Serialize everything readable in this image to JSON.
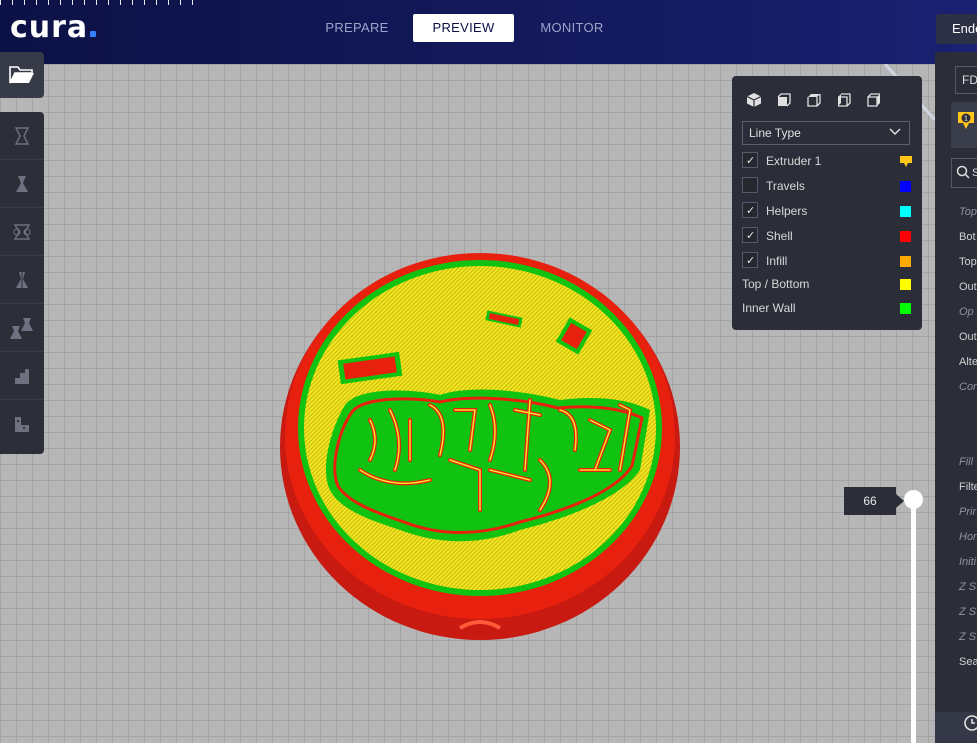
{
  "app": {
    "logo": "cura",
    "accent": "#3282ff"
  },
  "stages": [
    {
      "label": "PREPARE",
      "active": false
    },
    {
      "label": "PREVIEW",
      "active": true
    },
    {
      "label": "MONITOR",
      "active": false
    }
  ],
  "printer": {
    "name": "Ende"
  },
  "toolbar": {
    "open_icon": "folder-open-icon",
    "tools": [
      "move-icon",
      "scale-icon",
      "rotate-icon",
      "mirror-icon",
      "per-model-settings-icon",
      "support-blocker-icon",
      "layer-icon"
    ]
  },
  "legend": {
    "view_icons": [
      "3d-view-icon",
      "front-view-icon",
      "top-view-icon",
      "left-view-icon",
      "right-view-icon"
    ],
    "view_type": "Line Type",
    "checkbox_items": [
      {
        "label": "Extruder 1",
        "checked": true,
        "color": "#ffc619",
        "icon": "extruder-icon"
      },
      {
        "label": "Travels",
        "checked": false,
        "color": "#0000ff"
      },
      {
        "label": "Helpers",
        "checked": true,
        "color": "#00ffff"
      },
      {
        "label": "Shell",
        "checked": true,
        "color": "#ff0000"
      },
      {
        "label": "Infill",
        "checked": true,
        "color": "#ffaa00"
      }
    ],
    "plain_items": [
      {
        "label": "Top / Bottom",
        "color": "#ffff00"
      },
      {
        "label": "Inner Wall",
        "color": "#00ff00"
      }
    ]
  },
  "layer_slider": {
    "current": "66"
  },
  "side_panel": {
    "profile": "FDC",
    "extruder_number": "1",
    "search_placeholder": "S",
    "settings": [
      {
        "label": "Top",
        "italic": true
      },
      {
        "label": "Bot",
        "italic": false
      },
      {
        "label": "Top",
        "italic": false
      },
      {
        "label": "Out",
        "italic": false
      },
      {
        "label": "Op",
        "italic": true
      },
      {
        "label": "Out",
        "italic": false
      },
      {
        "label": "Alte",
        "italic": false
      },
      {
        "label": "Cor",
        "italic": true
      },
      {
        "label": "Fill",
        "italic": true
      },
      {
        "label": "Filte",
        "italic": false
      },
      {
        "label": "Prir",
        "italic": true
      },
      {
        "label": "Hor",
        "italic": true
      },
      {
        "label": "Initi",
        "italic": true
      },
      {
        "label": "Z S",
        "italic": true
      },
      {
        "label": "Z S",
        "italic": true
      },
      {
        "label": "Z S",
        "italic": true
      },
      {
        "label": "Sea",
        "italic": false
      }
    ]
  }
}
